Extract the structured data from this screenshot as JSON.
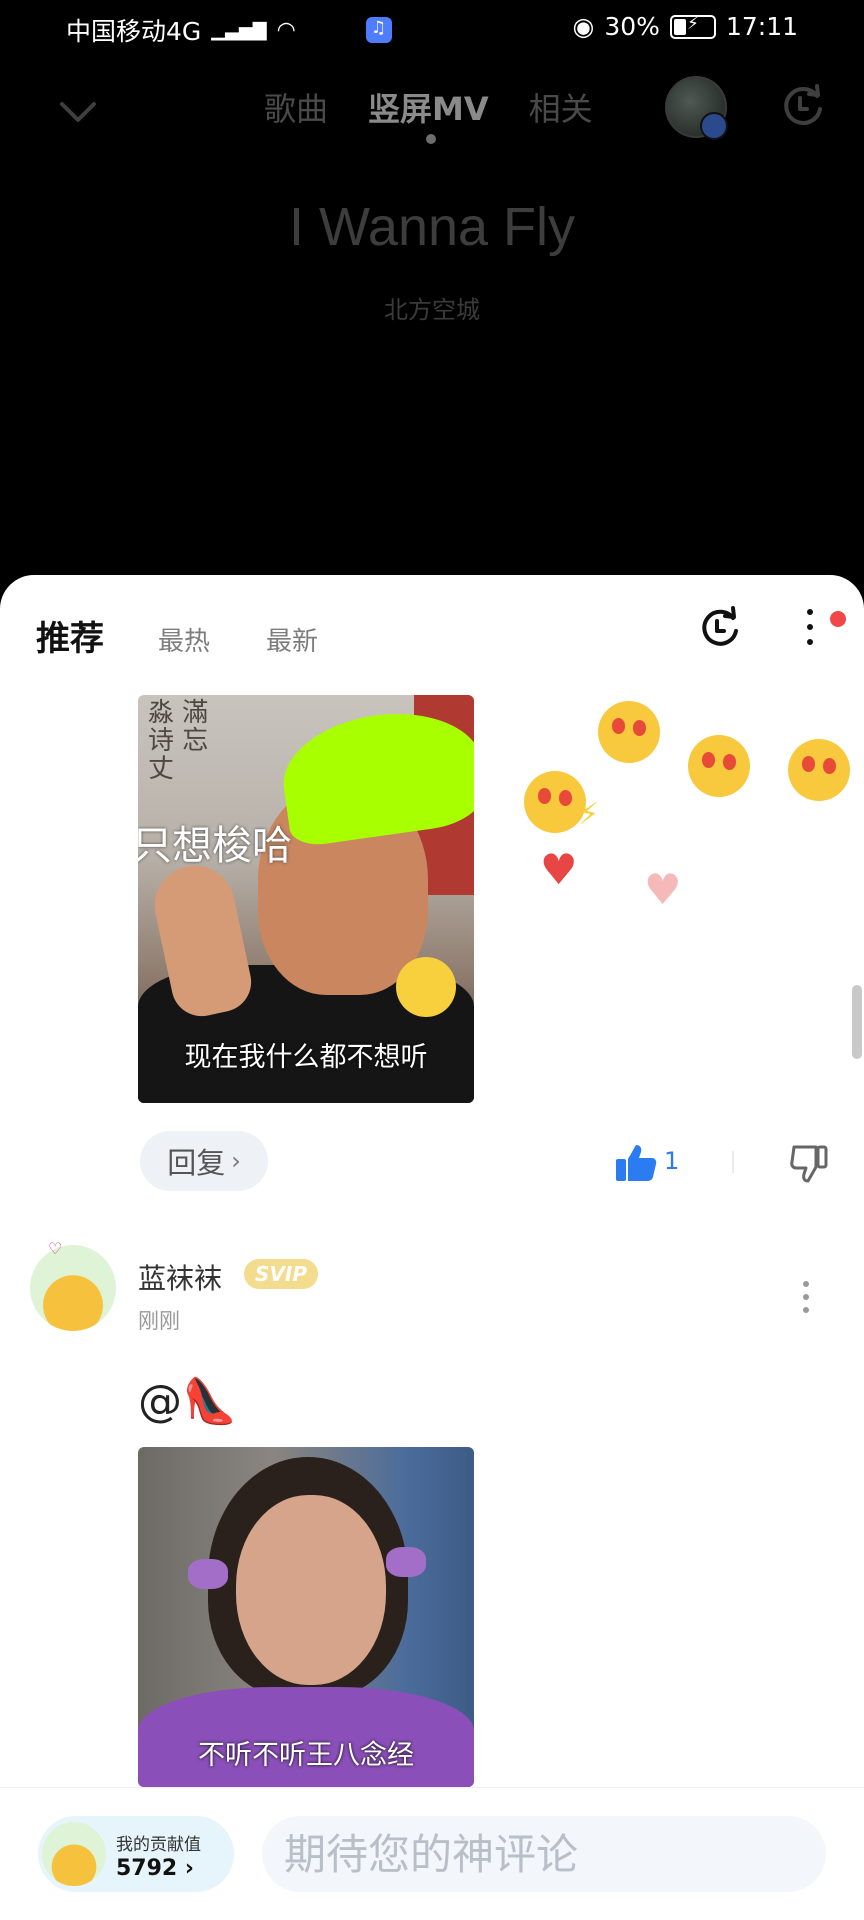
{
  "status_bar": {
    "carrier": "中国移动4G",
    "battery": "30%",
    "time": "17:11"
  },
  "top_nav": {
    "tabs": [
      {
        "label": "歌曲"
      },
      {
        "label": "竖屏MV"
      },
      {
        "label": "相关"
      }
    ],
    "active_tab_index": 1
  },
  "song": {
    "title": "I Wanna Fly",
    "singer": "北方空城"
  },
  "comments_panel": {
    "tabs": [
      {
        "label": "推荐"
      },
      {
        "label": "最热"
      },
      {
        "label": "最新"
      }
    ],
    "active_tab_index": 0,
    "has_notification": true
  },
  "comment1": {
    "meme_top_text": "只想梭哈",
    "meme_caption": "现在我什么都不想听",
    "reply_label": "回复",
    "like_count": "1"
  },
  "comment2": {
    "user_name": "蓝袜袜",
    "vip_badge": "SVIP",
    "time": "刚刚",
    "text_prefix": "@",
    "text_emoji": "👠",
    "meme_caption": "不听不听王八念经"
  },
  "bottom_bar": {
    "contribution_label": "我的贡献值",
    "contribution_value": "5792",
    "input_placeholder": "期待您的神评论"
  },
  "colors": {
    "accent_blue": "#2a7cf0",
    "notification_red": "#f04848",
    "svip_gold": "#f4dc8f"
  }
}
